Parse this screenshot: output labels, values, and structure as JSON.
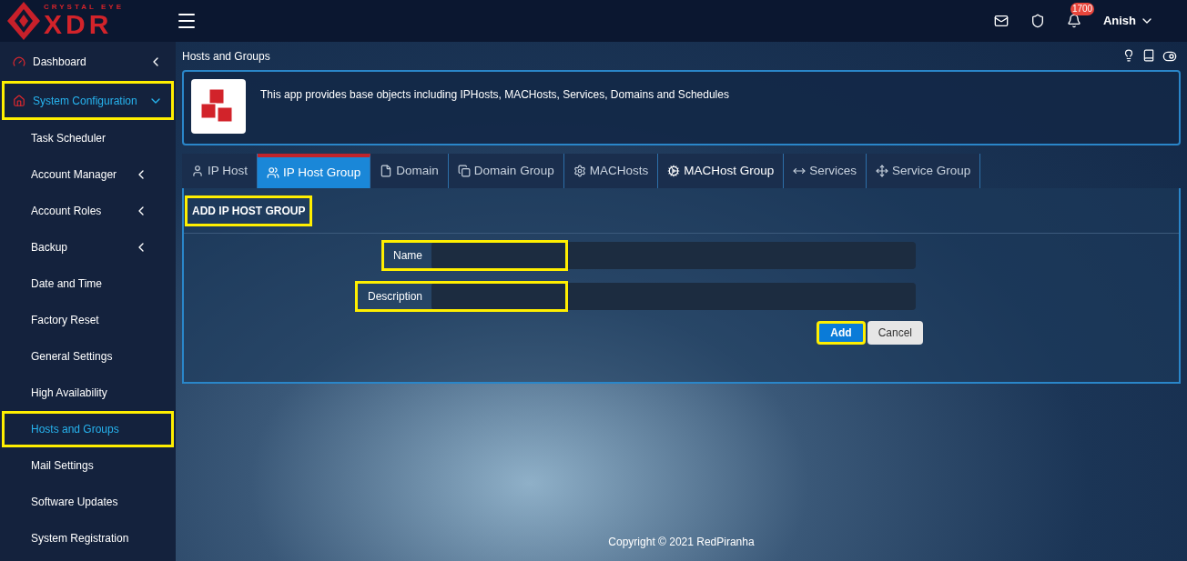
{
  "logo": {
    "top_text": "CRYSTAL EYE",
    "main_text": "XDR"
  },
  "header": {
    "notification_count": "1700",
    "user": "Anish"
  },
  "sidebar": {
    "items": [
      {
        "label": "Dashboard",
        "expanded": false,
        "selected": false,
        "highlighted": false
      },
      {
        "label": "System Configuration",
        "expanded": true,
        "selected": true,
        "highlighted": true,
        "children": [
          {
            "label": "Task Scheduler",
            "has_submenu": false,
            "selected": false,
            "highlighted": false
          },
          {
            "label": "Account Manager",
            "has_submenu": true,
            "selected": false,
            "highlighted": false
          },
          {
            "label": "Account Roles",
            "has_submenu": true,
            "selected": false,
            "highlighted": false
          },
          {
            "label": "Backup",
            "has_submenu": true,
            "selected": false,
            "highlighted": false
          },
          {
            "label": "Date and Time",
            "has_submenu": false,
            "selected": false,
            "highlighted": false
          },
          {
            "label": "Factory Reset",
            "has_submenu": false,
            "selected": false,
            "highlighted": false
          },
          {
            "label": "General Settings",
            "has_submenu": false,
            "selected": false,
            "highlighted": false
          },
          {
            "label": "High Availability",
            "has_submenu": false,
            "selected": false,
            "highlighted": false
          },
          {
            "label": "Hosts and Groups",
            "has_submenu": false,
            "selected": true,
            "highlighted": true
          },
          {
            "label": "Mail Settings",
            "has_submenu": false,
            "selected": false,
            "highlighted": false
          },
          {
            "label": "Software Updates",
            "has_submenu": false,
            "selected": false,
            "highlighted": false
          },
          {
            "label": "System Registration",
            "has_submenu": false,
            "selected": false,
            "highlighted": false
          }
        ]
      }
    ]
  },
  "page": {
    "title": "Hosts and Groups",
    "description": "This app provides base objects including IPHosts, MACHosts, Services, Domains and Schedules"
  },
  "tabs": [
    {
      "label": "IP Host",
      "selected": false,
      "bright": false
    },
    {
      "label": "IP Host Group",
      "selected": true,
      "bright": false
    },
    {
      "label": "Domain",
      "selected": false,
      "bright": false
    },
    {
      "label": "Domain Group",
      "selected": false,
      "bright": false
    },
    {
      "label": "MACHosts",
      "selected": false,
      "bright": false
    },
    {
      "label": "MACHost Group",
      "selected": false,
      "bright": true
    },
    {
      "label": "Services",
      "selected": false,
      "bright": false
    },
    {
      "label": "Service Group",
      "selected": false,
      "bright": false
    }
  ],
  "form": {
    "title": "ADD IP HOST GROUP",
    "title_highlighted": true,
    "fields": [
      {
        "label": "Name",
        "highlighted": true
      },
      {
        "label": "Description",
        "highlighted": true
      }
    ],
    "buttons": [
      {
        "label": "Add",
        "kind": "primary",
        "highlighted": true
      },
      {
        "label": "Cancel",
        "kind": "secondary",
        "highlighted": false
      }
    ]
  },
  "footer": {
    "copyright": "Copyright © 2021 RedPiranha"
  }
}
